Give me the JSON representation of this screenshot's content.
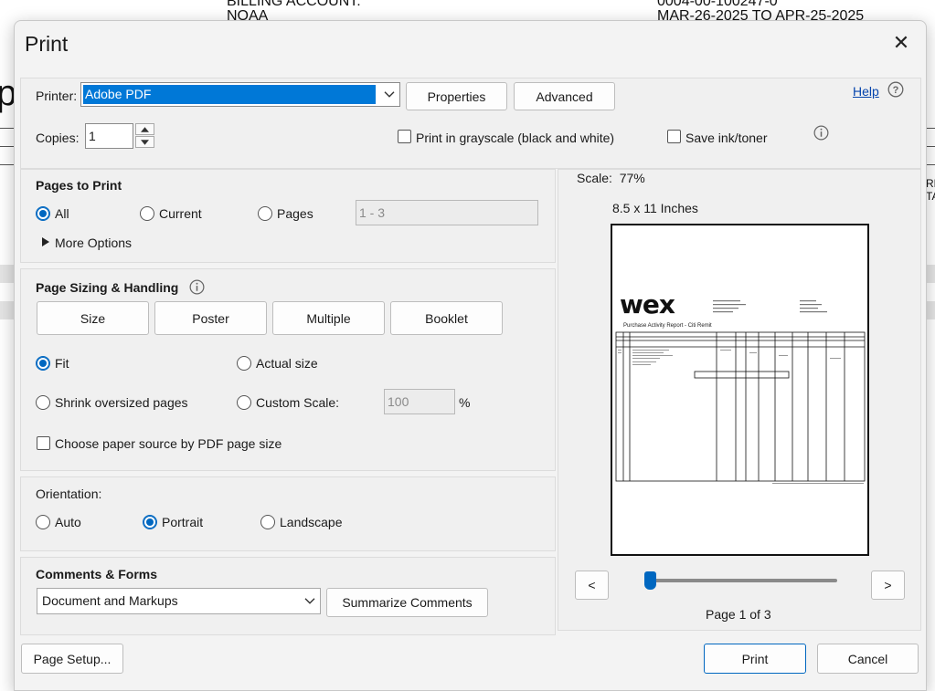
{
  "background": {
    "line1_left": "BILLING ACCOUNT:",
    "line1_right": "0004-00-100247-0",
    "line2_left": "NOAA",
    "line2_right": "MAR-26-2025 TO APR-25-2025",
    "big_letter": "p",
    "edge_text": [
      "RE",
      "TA"
    ]
  },
  "dialog": {
    "title": "Print",
    "close_glyph": "✕"
  },
  "top": {
    "printer_label": "Printer:",
    "printer_value": "Adobe PDF",
    "properties_label": "Properties",
    "advanced_label": "Advanced",
    "help_label": "Help",
    "copies_label": "Copies:",
    "copies_value": "1",
    "grayscale_label": "Print in grayscale (black and white)",
    "save_ink_label": "Save ink/toner"
  },
  "pages_to_print": {
    "title": "Pages to Print",
    "all_label": "All",
    "current_label": "Current",
    "pages_label": "Pages",
    "pages_range": "1 - 3",
    "more_options_label": "More Options"
  },
  "sizing": {
    "title": "Page Sizing & Handling",
    "tabs": [
      "Size",
      "Poster",
      "Multiple",
      "Booklet"
    ],
    "fit_label": "Fit",
    "actual_size_label": "Actual size",
    "shrink_label": "Shrink oversized pages",
    "custom_scale_label": "Custom Scale:",
    "custom_scale_value": "100",
    "percent": "%",
    "paper_source_label": "Choose paper source by PDF page size"
  },
  "orientation": {
    "title": "Orientation:",
    "auto_label": "Auto",
    "portrait_label": "Portrait",
    "landscape_label": "Landscape"
  },
  "comments": {
    "title": "Comments & Forms",
    "select_value": "Document and Markups",
    "summarize_label": "Summarize Comments"
  },
  "preview": {
    "scale_text": "Scale:  77%",
    "paper_size": "8.5 x 11 Inches",
    "page_logo": "wex",
    "page_subtitle": "Purchase Activity Report - Citi Remit",
    "prev_glyph": "<",
    "next_glyph": ">",
    "page_indicator": "Page 1 of 3"
  },
  "footer": {
    "page_setup_label": "Page Setup...",
    "print_label": "Print",
    "cancel_label": "Cancel"
  },
  "colors": {
    "accent": "#0067c0",
    "dialog_bg": "#f3f3f3",
    "panel_bg": "#f0f0f0",
    "selection": "#0078d7"
  }
}
